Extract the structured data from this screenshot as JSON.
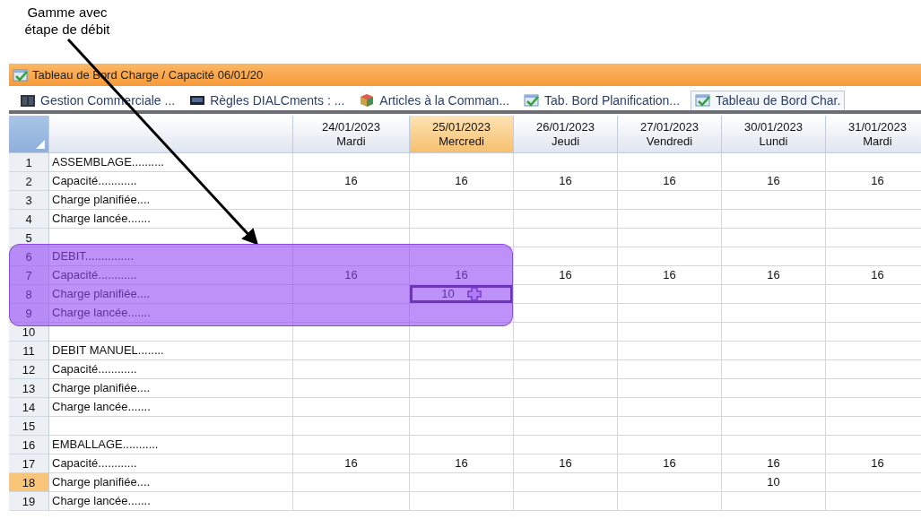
{
  "annotation": {
    "text": "Gamme avec étape de débit"
  },
  "window": {
    "title": "Tableau de Bord Charge / Capacité 06/01/20"
  },
  "tabs": [
    {
      "label": "Gestion Commerciale ...",
      "kind": "cabinet",
      "selected": false
    },
    {
      "label": "Règles DIALCments : ...",
      "kind": "screen",
      "selected": false
    },
    {
      "label": "Articles à la Comman...",
      "kind": "cube",
      "selected": false
    },
    {
      "label": "Tab. Bord Planification...",
      "kind": "chart",
      "selected": false
    },
    {
      "label": "Tableau de Bord Char.",
      "kind": "chart",
      "selected": true
    }
  ],
  "columns": [
    {
      "date": "24/01/2023",
      "day": "Mardi",
      "selected": false
    },
    {
      "date": "25/01/2023",
      "day": "Mercredi",
      "selected": true
    },
    {
      "date": "26/01/2023",
      "day": "Jeudi",
      "selected": false
    },
    {
      "date": "27/01/2023",
      "day": "Vendredi",
      "selected": false
    },
    {
      "date": "30/01/2023",
      "day": "Lundi",
      "selected": false
    },
    {
      "date": "31/01/2023",
      "day": "Mardi",
      "selected": false
    }
  ],
  "rows": [
    {
      "number": "1",
      "label": "ASSEMBLAGE..........",
      "selected": false,
      "highlighted": false,
      "cells": [
        {
          "focused": false
        },
        {
          "focused": false
        },
        {
          "focused": false
        },
        {
          "focused": false
        },
        {
          "focused": false
        },
        {
          "focused": false
        }
      ]
    },
    {
      "number": "2",
      "label": "Capacité............",
      "selected": false,
      "highlighted": false,
      "cells": [
        {
          "value": "16",
          "focused": false
        },
        {
          "value": "16",
          "focused": false
        },
        {
          "value": "16",
          "focused": false
        },
        {
          "value": "16",
          "focused": false
        },
        {
          "value": "16",
          "focused": false
        },
        {
          "value": "16",
          "focused": false
        }
      ]
    },
    {
      "number": "3",
      "label": "Charge planifiée....",
      "selected": false,
      "highlighted": false,
      "cells": [
        {
          "focused": false
        },
        {
          "focused": false
        },
        {
          "focused": false
        },
        {
          "focused": false
        },
        {
          "focused": false
        },
        {
          "focused": false
        }
      ]
    },
    {
      "number": "4",
      "label": "Charge lancée.......",
      "selected": false,
      "highlighted": false,
      "cells": [
        {
          "focused": false
        },
        {
          "focused": false
        },
        {
          "focused": false
        },
        {
          "focused": false
        },
        {
          "focused": false
        },
        {
          "focused": false
        }
      ]
    },
    {
      "number": "5",
      "selected": false,
      "highlighted": false,
      "cells": [
        {
          "focused": false
        },
        {
          "focused": false
        },
        {
          "focused": false
        },
        {
          "focused": false
        },
        {
          "focused": false
        },
        {
          "focused": false
        }
      ]
    },
    {
      "number": "6",
      "label": "DEBIT...............",
      "selected": false,
      "highlighted": true,
      "cells": [
        {
          "focused": false
        },
        {
          "focused": false
        },
        {
          "focused": false
        },
        {
          "focused": false
        },
        {
          "focused": false
        },
        {
          "focused": false
        }
      ]
    },
    {
      "number": "7",
      "label": "Capacité............",
      "selected": false,
      "highlighted": true,
      "cells": [
        {
          "value": "16",
          "focused": false
        },
        {
          "value": "16",
          "focused": false
        },
        {
          "value": "16",
          "focused": false
        },
        {
          "value": "16",
          "focused": false
        },
        {
          "value": "16",
          "focused": false
        },
        {
          "value": "16",
          "focused": false
        }
      ]
    },
    {
      "number": "8",
      "label": "Charge planifiée....",
      "selected": false,
      "highlighted": true,
      "cells": [
        {
          "focused": false
        },
        {
          "value": "10",
          "focused": true
        },
        {
          "focused": false
        },
        {
          "focused": false
        },
        {
          "focused": false
        },
        {
          "focused": false
        }
      ]
    },
    {
      "number": "9",
      "label": "Charge lancée.......",
      "selected": false,
      "highlighted": true,
      "cells": [
        {
          "focused": false
        },
        {
          "focused": false
        },
        {
          "focused": false
        },
        {
          "focused": false
        },
        {
          "focused": false
        },
        {
          "focused": false
        }
      ]
    },
    {
      "number": "10",
      "selected": false,
      "highlighted": false,
      "cells": [
        {
          "focused": false
        },
        {
          "focused": false
        },
        {
          "focused": false
        },
        {
          "focused": false
        },
        {
          "focused": false
        },
        {
          "focused": false
        }
      ]
    },
    {
      "number": "11",
      "label": "DEBIT MANUEL........",
      "selected": false,
      "highlighted": false,
      "cells": [
        {
          "focused": false
        },
        {
          "focused": false
        },
        {
          "focused": false
        },
        {
          "focused": false
        },
        {
          "focused": false
        },
        {
          "focused": false
        }
      ]
    },
    {
      "number": "12",
      "label": "Capacité............",
      "selected": false,
      "highlighted": false,
      "cells": [
        {
          "focused": false
        },
        {
          "focused": false
        },
        {
          "focused": false
        },
        {
          "focused": false
        },
        {
          "focused": false
        },
        {
          "focused": false
        }
      ]
    },
    {
      "number": "13",
      "label": "Charge planifiée....",
      "selected": false,
      "highlighted": false,
      "cells": [
        {
          "focused": false
        },
        {
          "focused": false
        },
        {
          "focused": false
        },
        {
          "focused": false
        },
        {
          "focused": false
        },
        {
          "focused": false
        }
      ]
    },
    {
      "number": "14",
      "label": "Charge lancée.......",
      "selected": false,
      "highlighted": false,
      "cells": [
        {
          "focused": false
        },
        {
          "focused": false
        },
        {
          "focused": false
        },
        {
          "focused": false
        },
        {
          "focused": false
        },
        {
          "focused": false
        }
      ]
    },
    {
      "number": "15",
      "selected": false,
      "highlighted": false,
      "cells": [
        {
          "focused": false
        },
        {
          "focused": false
        },
        {
          "focused": false
        },
        {
          "focused": false
        },
        {
          "focused": false
        },
        {
          "focused": false
        }
      ]
    },
    {
      "number": "16",
      "label": "EMBALLAGE...........",
      "selected": false,
      "highlighted": false,
      "cells": [
        {
          "focused": false
        },
        {
          "focused": false
        },
        {
          "focused": false
        },
        {
          "focused": false
        },
        {
          "focused": false
        },
        {
          "focused": false
        }
      ]
    },
    {
      "number": "17",
      "label": "Capacité............",
      "selected": false,
      "highlighted": false,
      "cells": [
        {
          "value": "16",
          "focused": false
        },
        {
          "value": "16",
          "focused": false
        },
        {
          "value": "16",
          "focused": false
        },
        {
          "value": "16",
          "focused": false
        },
        {
          "value": "16",
          "focused": false
        },
        {
          "value": "16",
          "focused": false
        }
      ]
    },
    {
      "number": "18",
      "label": "Charge planifiée....",
      "selected": true,
      "highlighted": false,
      "cells": [
        {
          "focused": false
        },
        {
          "focused": false
        },
        {
          "focused": false
        },
        {
          "focused": false
        },
        {
          "value": "10",
          "focused": false
        },
        {
          "focused": false
        }
      ]
    },
    {
      "number": "19",
      "label": "Charge lancée.......",
      "selected": false,
      "highlighted": false,
      "cells": [
        {
          "focused": false
        },
        {
          "focused": false
        },
        {
          "focused": false
        },
        {
          "focused": false
        },
        {
          "focused": false
        },
        {
          "focused": false
        }
      ]
    }
  ]
}
